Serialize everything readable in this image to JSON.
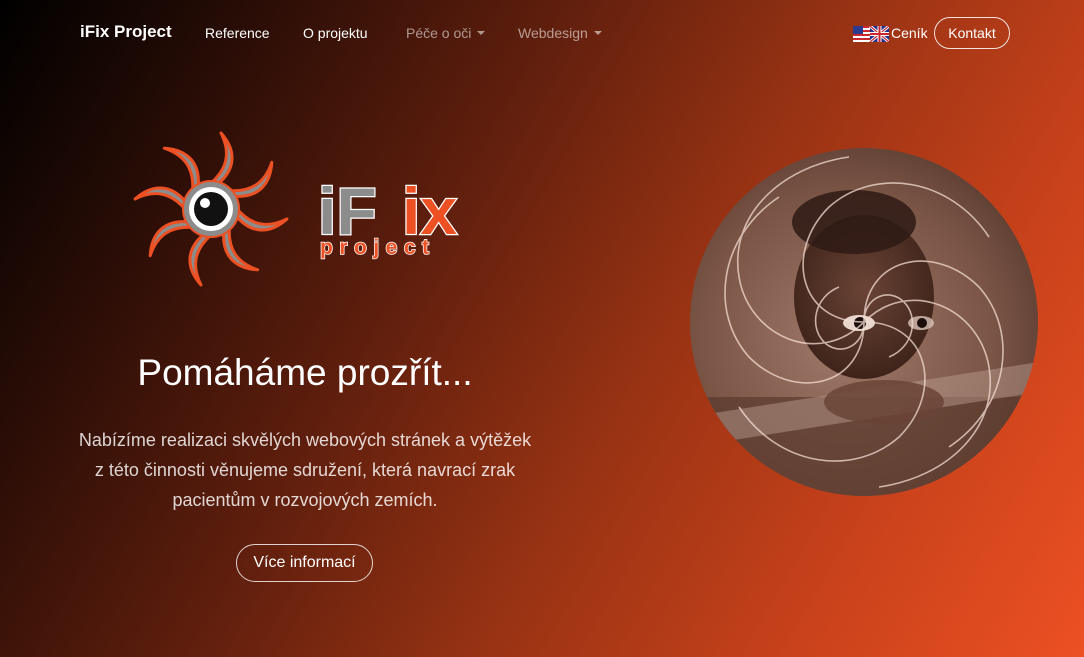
{
  "nav": {
    "brand": "iFix Project",
    "items": [
      {
        "label": "Reference"
      },
      {
        "label": "O projektu"
      },
      {
        "label": "Péče o oči"
      },
      {
        "label": "Webdesign"
      }
    ],
    "price_label": "Ceník",
    "contact_label": "Kontakt",
    "language_icon": "uk-us-flag-icon"
  },
  "logo": {
    "word": "iFix",
    "sub": "project",
    "colors": {
      "gray": "#8c8c8c",
      "orange": "#ec5023"
    }
  },
  "hero": {
    "title": "Pomáháme prozřít...",
    "lead_lines": [
      "Nabízíme realizaci skvělých webových stránek a výtěžek",
      "z této činnosti věnujeme sdružení, která navrací zrak",
      "pacientům v rozvojových zemích."
    ],
    "button_label": "Více informací"
  },
  "colors": {
    "accent": "#ec5023",
    "gradient_dark": "#000000"
  }
}
